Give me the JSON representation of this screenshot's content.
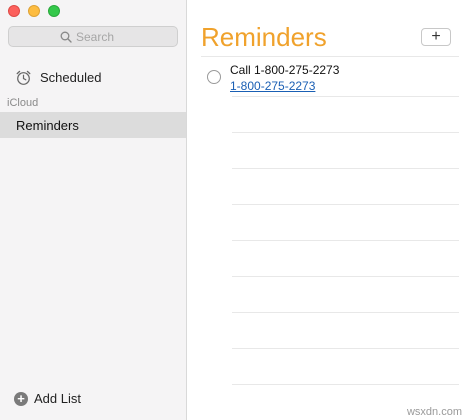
{
  "sidebar": {
    "search": {
      "placeholder": "Search"
    },
    "scheduled_label": "Scheduled",
    "section": "iCloud",
    "lists": [
      {
        "label": "Reminders"
      }
    ],
    "add_list_label": "Add List"
  },
  "main": {
    "title": "Reminders",
    "add_button": "+",
    "reminders": [
      {
        "title": "Call 1-800-275-2273",
        "link": "1-800-275-2273"
      }
    ]
  },
  "watermark": "wsxdn.com",
  "colors": {
    "title": "#f0a22c",
    "link": "#1a5fb4",
    "close": "#fc605c",
    "minimize": "#fdbc40",
    "zoom": "#34c84a"
  }
}
